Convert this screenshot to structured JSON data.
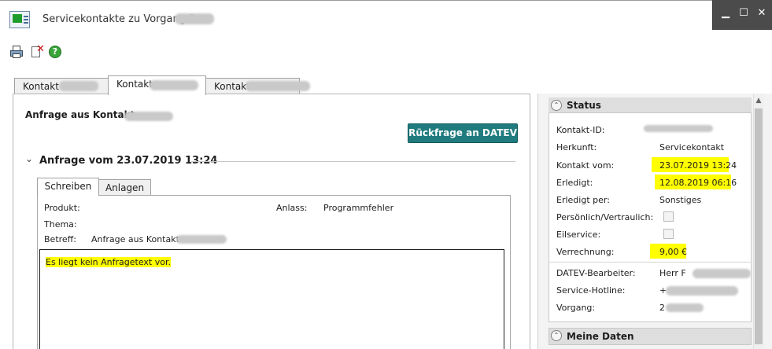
{
  "window": {
    "title": "Servicekontakte zu Vorgang 2",
    "controls": {
      "minimize": "▁",
      "maximize": "☐",
      "close": "✕"
    }
  },
  "toolbar": {
    "icons": [
      "print-icon",
      "delete-document-icon",
      "help-icon"
    ],
    "help_glyph": "?"
  },
  "tabs": [
    {
      "label": "Kontakt"
    },
    {
      "label": "Kontakt"
    },
    {
      "label": "Kontakt"
    }
  ],
  "main": {
    "title": "Anfrage aus Kontakt",
    "rueckfrage_button": "Rückfrage an DATEV",
    "request_header": "Anfrage vom 23.07.2019 13:24",
    "subtabs": [
      "Schreiben",
      "Anlagen"
    ],
    "fields": {
      "produkt_label": "Produkt:",
      "thema_label": "Thema:",
      "betreff_label": "Betreff:",
      "betreff_value": "Anfrage aus Kontakt",
      "anlass_label": "Anlass:",
      "anlass_value": "Programmfehler"
    },
    "message_text": "Es liegt kein Anfragetext vor."
  },
  "status": {
    "title": "Status",
    "rows": [
      {
        "label": "Kontakt-ID:",
        "value": ""
      },
      {
        "label": "Herkunft:",
        "value": "Servicekontakt"
      },
      {
        "label": "Kontakt vom:",
        "value": "23.07.2019 13:24"
      },
      {
        "label": "Erledigt:",
        "value": "12.08.2019 06:16"
      },
      {
        "label": "Erledigt per:",
        "value": "Sonstiges"
      },
      {
        "label": "Persönlich/Vertraulich:",
        "checked": false
      },
      {
        "label": "Eilservice:",
        "checked": false
      },
      {
        "label": "Verrechnung:",
        "value": "9,00 €"
      },
      {
        "label": "DATEV-Bearbeiter:",
        "value": "Herr F"
      },
      {
        "label": "Service-Hotline:",
        "value": "+"
      },
      {
        "label": "Vorgang:",
        "value": "2"
      }
    ]
  },
  "meine_daten": {
    "title": "Meine Daten"
  },
  "colors": {
    "accent_button": "#1f7b7e",
    "highlight": "#ffff00",
    "window_controls_bg": "#4b4b4b"
  }
}
